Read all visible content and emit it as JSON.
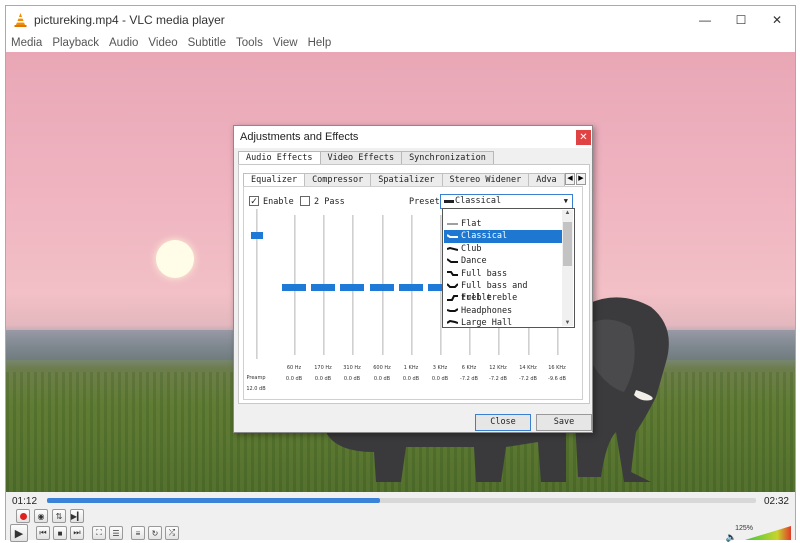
{
  "window": {
    "title": "pictureking.mp4 - VLC media player",
    "minimize": "—",
    "maximize": "☐",
    "close": "✕"
  },
  "menu": [
    "Media",
    "Playback",
    "Audio",
    "Video",
    "Subtitle",
    "Tools",
    "View",
    "Help"
  ],
  "player": {
    "time_current": "01:12",
    "time_total": "02:32",
    "progress": 0.47,
    "volume": "125%",
    "volume_level": 1.0
  },
  "dialog": {
    "title": "Adjustments and Effects",
    "close": "✕",
    "tabs": [
      "Audio Effects",
      "Video Effects",
      "Synchronization"
    ],
    "subtabs": [
      "Equalizer",
      "Compressor",
      "Spatializer",
      "Stereo Widener",
      "Adva"
    ],
    "enable_label": "Enable",
    "enable_checked": true,
    "twopass_label": "2 Pass",
    "twopass_checked": false,
    "preset_label": "Preset",
    "preset_value": "Classical",
    "preamp": {
      "label": "Preamp",
      "value": "12.0 dB",
      "level": 0.85
    },
    "bands": [
      {
        "freq": "60 Hz",
        "db": "0.0 dB",
        "level": 0.5
      },
      {
        "freq": "170 Hz",
        "db": "0.0 dB",
        "level": 0.5
      },
      {
        "freq": "310 Hz",
        "db": "0.0 dB",
        "level": 0.5
      },
      {
        "freq": "600 Hz",
        "db": "0.0 dB",
        "level": 0.5
      },
      {
        "freq": "1 KHz",
        "db": "0.0 dB",
        "level": 0.5
      },
      {
        "freq": "3 KHz",
        "db": "0.0 dB",
        "level": 0.5
      },
      {
        "freq": "6 KHz",
        "db": "-7.2 dB",
        "level": 0.32
      },
      {
        "freq": "12 KHz",
        "db": "-7.2 dB",
        "level": 0.32
      },
      {
        "freq": "14 KHz",
        "db": "-7.2 dB",
        "level": 0.32
      },
      {
        "freq": "16 KHz",
        "db": "-9.6 dB",
        "level": 0.26
      }
    ],
    "close_button": "Close",
    "save_button": "Save",
    "preset_options": [
      "Flat",
      "Classical",
      "Club",
      "Dance",
      "Full bass",
      "Full bass and treble",
      "Full treble",
      "Headphones",
      "Large Hall"
    ],
    "preset_selected_index": 1
  },
  "colors": {
    "accent": "#1e7ad6",
    "seek_fill": "#3b83d8",
    "close_red": "#e04343"
  }
}
